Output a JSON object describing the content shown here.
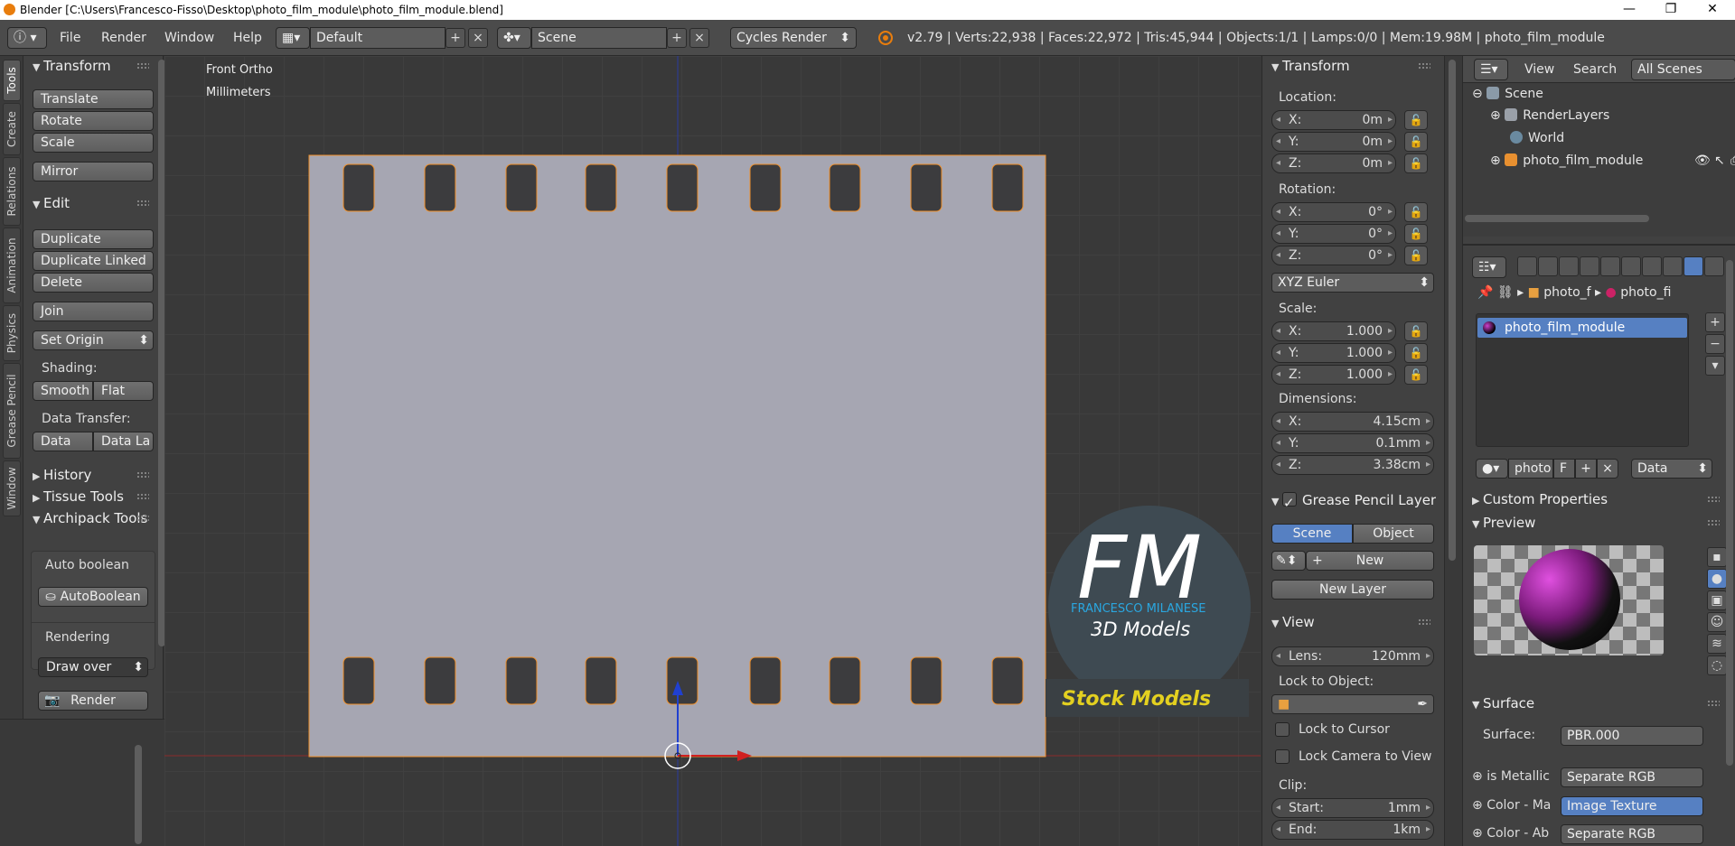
{
  "titlebar": {
    "title": "Blender [C:\\Users\\Francesco-Fisso\\Desktop\\photo_film_module\\photo_film_module.blend]",
    "minimize": "—",
    "maximize": "❐",
    "close": "✕"
  },
  "header": {
    "menus": [
      "File",
      "Render",
      "Window",
      "Help"
    ],
    "screen_layout": "Default",
    "scene": "Scene",
    "render_engine": "Cycles Render",
    "stats": "v2.79 | Verts:22,938 | Faces:22,972 | Tris:45,944 | Objects:1/1 | Lamps:0/0 | Mem:19.98M | photo_film_module"
  },
  "left_tabs": [
    "Tools",
    "Create",
    "Relations",
    "Animation",
    "Physics",
    "Grease Pencil",
    "Window"
  ],
  "toolshelf": {
    "transform": {
      "title": "Transform",
      "translate": "Translate",
      "rotate": "Rotate",
      "scale": "Scale",
      "mirror": "Mirror"
    },
    "edit": {
      "title": "Edit",
      "duplicate": "Duplicate",
      "duplicate_linked": "Duplicate Linked",
      "delete": "Delete",
      "join": "Join",
      "set_origin": "Set Origin",
      "shading_label": "Shading:",
      "smooth": "Smooth",
      "flat": "Flat",
      "data_transfer_label": "Data Transfer:",
      "data": "Data",
      "data_la": "Data La"
    },
    "history": "History",
    "tissue_tools": "Tissue Tools",
    "archipack": {
      "title": "Archipack Tools",
      "auto_boolean_label": "Auto boolean",
      "autoboolean": "AutoBoolean",
      "rendering_label": "Rendering",
      "draw_over": "Draw over",
      "render": "Render"
    }
  },
  "viewport": {
    "view_name": "Front Ortho",
    "units": "Millimeters",
    "watermark_fm": "FM",
    "watermark_name": "FRANCESCO MILANESE",
    "watermark_3d": "3D Models",
    "watermark_stock": "Stock Models",
    "colors": {
      "film": "#a6a6b2",
      "hole": "#3c3c3e",
      "outline": "#f0902a"
    }
  },
  "npanel": {
    "transform_title": "Transform",
    "location_label": "Location:",
    "location": [
      {
        "k": "X:",
        "v": "0m"
      },
      {
        "k": "Y:",
        "v": "0m"
      },
      {
        "k": "Z:",
        "v": "0m"
      }
    ],
    "rotation_label": "Rotation:",
    "rotation": [
      {
        "k": "X:",
        "v": "0°"
      },
      {
        "k": "Y:",
        "v": "0°"
      },
      {
        "k": "Z:",
        "v": "0°"
      }
    ],
    "rotation_mode": "XYZ Euler",
    "scale_label": "Scale:",
    "scale": [
      {
        "k": "X:",
        "v": "1.000"
      },
      {
        "k": "Y:",
        "v": "1.000"
      },
      {
        "k": "Z:",
        "v": "1.000"
      }
    ],
    "dimensions_label": "Dimensions:",
    "dimensions": [
      {
        "k": "X:",
        "v": "4.15cm"
      },
      {
        "k": "Y:",
        "v": "0.1mm"
      },
      {
        "k": "Z:",
        "v": "3.38cm"
      }
    ],
    "grease_pencil_title": "Grease Pencil Layers",
    "gp_scene": "Scene",
    "gp_object": "Object",
    "gp_new": "New",
    "gp_new_layer": "New Layer",
    "view_title": "View",
    "lens_label": "Lens:",
    "lens_value": "120mm",
    "lock_to_object_label": "Lock to Object:",
    "lock_to_cursor": "Lock to Cursor",
    "lock_camera_to_view": "Lock Camera to View",
    "clip_label": "Clip:",
    "clip_start_label": "Start:",
    "clip_start": "1mm",
    "clip_end_label": "End:",
    "clip_end": "1km"
  },
  "outliner": {
    "view": "View",
    "search": "Search",
    "filter": "All Scenes",
    "items": [
      "Scene",
      "RenderLayers",
      "World",
      "photo_film_module"
    ]
  },
  "properties": {
    "crumb1": "photo_f",
    "crumb2": "photo_fi",
    "material_slot": "photo_film_module",
    "material_field": "photo",
    "material_f": "F",
    "data_select": "Data",
    "custom_properties": "Custom Properties",
    "preview": "Preview",
    "surface": "Surface",
    "surface_label": "Surface:",
    "surface_value": "PBR.000",
    "rows": [
      {
        "k": "is Metallic",
        "v": "Separate RGB"
      },
      {
        "k": "Color - Ma",
        "v": "Image Texture"
      },
      {
        "k": "Color - Ab",
        "v": "Separate RGB"
      }
    ]
  }
}
